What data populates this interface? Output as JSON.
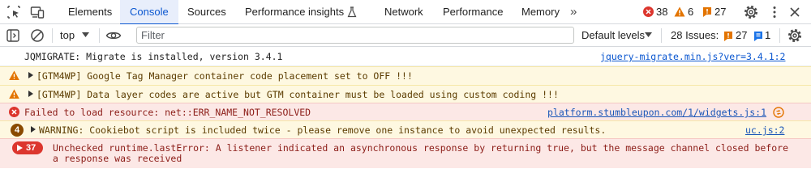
{
  "tabbar": {
    "tabs": [
      {
        "label": "Elements"
      },
      {
        "label": "Console"
      },
      {
        "label": "Sources"
      },
      {
        "label": "Performance insights"
      },
      {
        "label": "Network"
      },
      {
        "label": "Performance"
      },
      {
        "label": "Memory"
      }
    ],
    "active_tab": "Console",
    "more_tabs_label": "»",
    "error_count": "38",
    "warning_count": "6",
    "issue_count": "27"
  },
  "filterbar": {
    "context": "top",
    "filter_placeholder": "Filter",
    "levels_label": "Default levels",
    "issues_label": "28 Issues:",
    "issues_warning_count": "27",
    "issues_info_count": "1"
  },
  "console": {
    "messages": [
      {
        "level": "info",
        "text": "JQMIGRATE: Migrate is installed, version 3.4.1",
        "source": "jquery-migrate.min.js?ver=3.4.1:2"
      },
      {
        "level": "warning",
        "text": "[GTM4WP] Google Tag Manager container code placement set to OFF !!!",
        "source": ""
      },
      {
        "level": "warning",
        "text": "[GTM4WP] Data layer codes are active but GTM container must be loaded using custom coding !!!",
        "source": ""
      },
      {
        "level": "error",
        "text": "Failed to load resource: net::ERR_NAME_NOT_RESOLVED",
        "source": "platform.stumbleupon.com/1/widgets.js:1"
      },
      {
        "level": "warning",
        "repeat": "4",
        "text": "WARNING: Cookiebot script is included twice - please remove one instance to avoid unexpected results.",
        "source": "uc.js:2"
      },
      {
        "level": "error",
        "repeat": "37",
        "text": "Unchecked runtime.lastError: A listener indicated an asynchronous response by returning true, but the message channel closed before",
        "text_cont": "a response was received",
        "source": ""
      }
    ]
  },
  "colors": {
    "accent": "#0b57d0",
    "error": "#dc362e",
    "warning": "#e37400",
    "warning_bg": "#fef8e1",
    "error_bg": "#fce8e6"
  },
  "icons": {
    "inspect": "select-element-icon",
    "device": "device-toolbar-icon",
    "flask": "experimental-flask-icon",
    "settings": "gear-icon",
    "menu": "kebab-menu-icon",
    "close": "close-icon",
    "sidebar": "sidebar-toggle-icon",
    "clear": "clear-console-icon",
    "eye": "live-expression-eye-icon"
  }
}
